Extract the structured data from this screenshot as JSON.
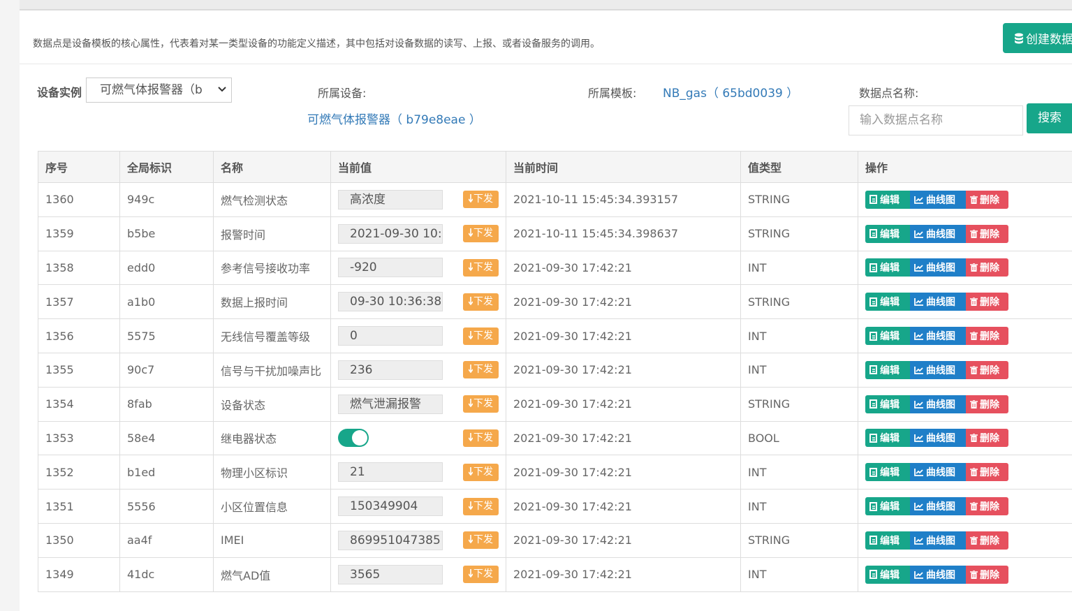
{
  "header": {
    "description": "数据点是设备模板的核心属性，代表着对某一类型设备的功能定义描述，其中包括对设备数据的读写、上报、或者设备服务的调用。",
    "create_button": "创建数据"
  },
  "filters": {
    "instance_label": "设备实例",
    "instance_value": "可燃气体报警器（b",
    "device_label": "所属设备:",
    "device_value": "可燃气体报警器（ b79e8eae ）",
    "template_label": "所属模板:",
    "template_value": "NB_gas（ 65bd0039 ）",
    "name_label": "数据点名称:",
    "name_placeholder": "输入数据点名称",
    "search_button": "搜索"
  },
  "table": {
    "headers": [
      "序号",
      "全局标识",
      "名称",
      "当前值",
      "当前时间",
      "值类型",
      "操作"
    ],
    "issue_label": "下发",
    "actions": {
      "edit": "编辑",
      "curve": "曲线图",
      "delete": "删除"
    },
    "rows": [
      {
        "id": "1360",
        "key": "949c",
        "name": "燃气检测状态",
        "value": "高浓度",
        "time": "2021-10-11 15:45:34.393157",
        "type": "STRING"
      },
      {
        "id": "1359",
        "key": "b5be",
        "name": "报警时间",
        "value": "2021-09-30 10:",
        "time": "2021-10-11 15:45:34.398637",
        "type": "STRING"
      },
      {
        "id": "1358",
        "key": "edd0",
        "name": "参考信号接收功率",
        "value": "-920",
        "time": "2021-09-30 17:42:21",
        "type": "INT"
      },
      {
        "id": "1357",
        "key": "a1b0",
        "name": "数据上报时间",
        "value": "09-30 10:36:38",
        "time": "2021-09-30 17:42:21",
        "type": "STRING"
      },
      {
        "id": "1356",
        "key": "5575",
        "name": "无线信号覆盖等级",
        "value": "0",
        "time": "2021-09-30 17:42:21",
        "type": "INT"
      },
      {
        "id": "1355",
        "key": "90c7",
        "name": "信号与干扰加噪声比",
        "value": "236",
        "time": "2021-09-30 17:42:21",
        "type": "INT"
      },
      {
        "id": "1354",
        "key": "8fab",
        "name": "设备状态",
        "value": "燃气泄漏报警",
        "time": "2021-09-30 17:42:21",
        "type": "STRING"
      },
      {
        "id": "1353",
        "key": "58e4",
        "name": "继电器状态",
        "value": "",
        "toggle": true,
        "time": "2021-09-30 17:42:21",
        "type": "BOOL"
      },
      {
        "id": "1352",
        "key": "b1ed",
        "name": "物理小区标识",
        "value": "21",
        "time": "2021-09-30 17:42:21",
        "type": "INT"
      },
      {
        "id": "1351",
        "key": "5556",
        "name": "小区位置信息",
        "value": "150349904",
        "time": "2021-09-30 17:42:21",
        "type": "INT"
      },
      {
        "id": "1350",
        "key": "aa4f",
        "name": "IMEI",
        "value": "869951047385",
        "time": "2021-09-30 17:42:21",
        "type": "STRING"
      },
      {
        "id": "1349",
        "key": "41dc",
        "name": "燃气AD值",
        "value": "3565",
        "time": "2021-09-30 17:42:21",
        "type": "INT"
      }
    ]
  }
}
